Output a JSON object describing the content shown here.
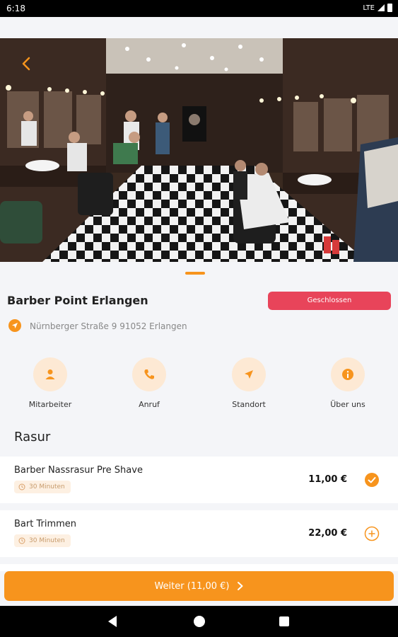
{
  "status_bar": {
    "time": "6:18",
    "network": "LTE"
  },
  "shop": {
    "name": "Barber Point Erlangen",
    "status": "Geschlossen",
    "address": "Nürnberger Straße 9 91052 Erlangen"
  },
  "actions": [
    {
      "label": "Mitarbeiter",
      "icon": "person-icon"
    },
    {
      "label": "Anruf",
      "icon": "phone-icon"
    },
    {
      "label": "Standort",
      "icon": "navigation-icon"
    },
    {
      "label": "Über uns",
      "icon": "info-icon"
    }
  ],
  "section": {
    "title": "Rasur"
  },
  "services": [
    {
      "name": "Barber Nassrasur Pre Shave",
      "duration": "30 Minuten",
      "price": "11,00 €",
      "selected": true
    },
    {
      "name": "Bart Trimmen",
      "duration": "30 Minuten",
      "price": "22,00 €",
      "selected": false
    }
  ],
  "cta": {
    "label": "Weiter (11,00 €)"
  },
  "colors": {
    "accent": "#f7941d",
    "closed": "#e8445a",
    "icon_bg": "#fde9d4"
  }
}
